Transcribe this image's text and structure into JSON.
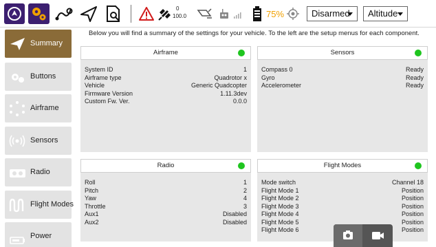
{
  "toolbar": {
    "satellite_count": "0",
    "hdop": "100.0",
    "battery": "75%",
    "flight_mode": "Disarmed",
    "altitude_mode": "Altitude"
  },
  "sidebar": {
    "items": [
      {
        "label": "Summary",
        "icon": "paper-plane-icon"
      },
      {
        "label": "Buttons",
        "icon": "gamepad-icon"
      },
      {
        "label": "Airframe",
        "icon": "airframe-icon"
      },
      {
        "label": "Sensors",
        "icon": "sensors-icon"
      },
      {
        "label": "Radio",
        "icon": "radio-icon"
      },
      {
        "label": "Flight Modes",
        "icon": "flight-modes-icon"
      },
      {
        "label": "Power",
        "icon": "battery-icon"
      }
    ]
  },
  "main": {
    "intro": "Below you will find a summary of the settings for your vehicle. To the left are the setup menus for each component.",
    "cards": {
      "airframe": {
        "title": "Airframe",
        "rows": [
          {
            "k": "System ID",
            "v": "1"
          },
          {
            "k": "Airframe type",
            "v": "Quadrotor x"
          },
          {
            "k": "Vehicle",
            "v": "Generic Quadcopter"
          },
          {
            "k": "Firmware Version",
            "v": "1.11.3dev"
          },
          {
            "k": "Custom Fw. Ver.",
            "v": "0.0.0"
          }
        ]
      },
      "sensors": {
        "title": "Sensors",
        "rows": [
          {
            "k": "Compass 0",
            "v": "Ready"
          },
          {
            "k": "Gyro",
            "v": "Ready"
          },
          {
            "k": "Accelerometer",
            "v": "Ready"
          }
        ]
      },
      "radio": {
        "title": "Radio",
        "rows": [
          {
            "k": "Roll",
            "v": "1"
          },
          {
            "k": "Pitch",
            "v": "2"
          },
          {
            "k": "Yaw",
            "v": "4"
          },
          {
            "k": "Throttle",
            "v": "3"
          },
          {
            "k": "Aux1",
            "v": "Disabled"
          },
          {
            "k": "Aux2",
            "v": "Disabled"
          }
        ]
      },
      "flight_modes": {
        "title": "Flight Modes",
        "rows": [
          {
            "k": "Mode switch",
            "v": "Channel 18"
          },
          {
            "k": "Flight Mode 1",
            "v": "Position"
          },
          {
            "k": "Flight Mode 2",
            "v": "Position"
          },
          {
            "k": "Flight Mode 3",
            "v": "Position"
          },
          {
            "k": "Flight Mode 4",
            "v": "Position"
          },
          {
            "k": "Flight Mode 5",
            "v": "Position"
          },
          {
            "k": "Flight Mode 6",
            "v": "Position"
          }
        ]
      }
    },
    "status_color": "#1fc51f"
  },
  "colors": {
    "toolbar_accent": "#3c1f70",
    "active_item": "#8a6b38",
    "battery": "#f0a000",
    "warning": "#d11b1b"
  }
}
